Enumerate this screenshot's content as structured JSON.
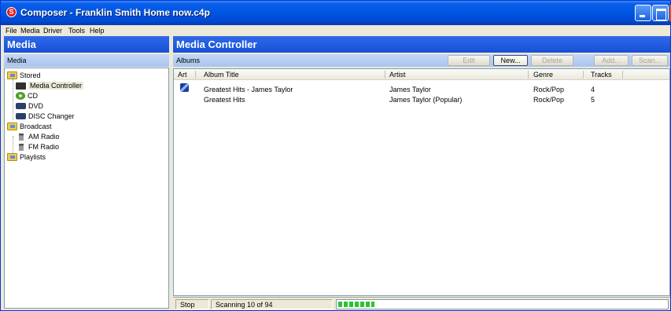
{
  "window": {
    "title": "Composer - Franklin Smith Home now.c4p",
    "app_icon_letter": "S"
  },
  "menu": [
    {
      "label": "File"
    },
    {
      "label": "Media"
    },
    {
      "label": "Driver"
    },
    {
      "label": "Tools"
    },
    {
      "label": "Help"
    }
  ],
  "left_pane": {
    "header": "Media",
    "subheader": "Media",
    "tree": {
      "stored": "Stored",
      "media_controller": "Media Controller",
      "cd": "CD",
      "dvd": "DVD",
      "disc_changer": "DISC Changer",
      "broadcast": "Broadcast",
      "am_radio": "AM Radio",
      "fm_radio": "FM Radio",
      "playlists": "Playlists"
    }
  },
  "right_pane": {
    "header": "Media Controller",
    "toolbar": {
      "section_label": "Albums",
      "edit": "Edit",
      "new": "New...",
      "delete": "Delete",
      "add": "Add...",
      "scan": "Scan..."
    },
    "columns": {
      "art": "Art",
      "album_title": "Album Title",
      "artist": "Artist",
      "genre": "Genre",
      "tracks": "Tracks"
    },
    "rows": [
      {
        "album_title": "Greatest Hits - James Taylor",
        "artist": "James Taylor",
        "genre": "Rock/Pop",
        "tracks": "4"
      },
      {
        "album_title": "Greatest Hits",
        "artist": "James Taylor (Popular)",
        "genre": "Rock/Pop",
        "tracks": "5"
      }
    ]
  },
  "status": {
    "stop": "Stop",
    "scanning": "Scanning 10 of 94",
    "progress_fraction": 0.11
  },
  "colors": {
    "title_bar": "#0054e3",
    "pane_header": "#1750d8",
    "progress": "#2fc22f"
  }
}
